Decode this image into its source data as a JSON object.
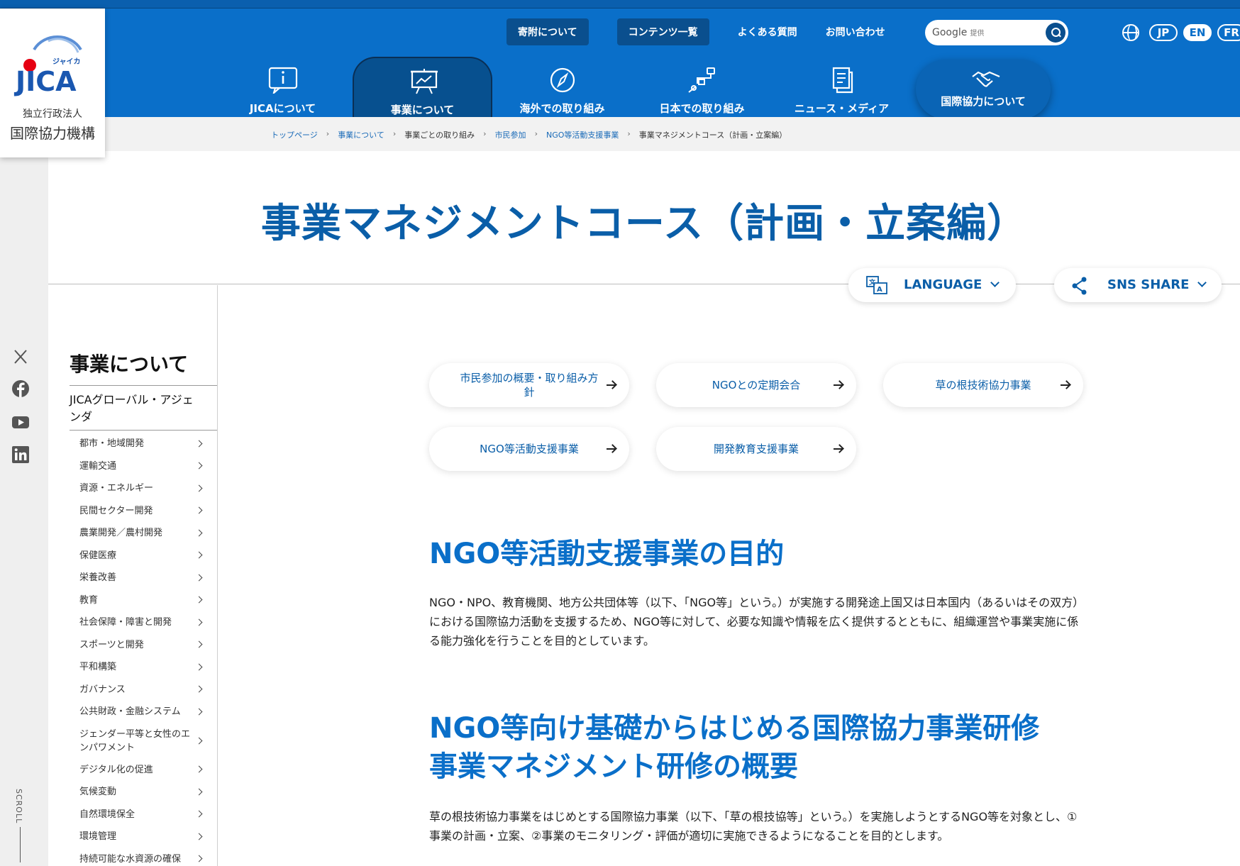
{
  "brand": {
    "logo_text": "JICA",
    "logo_kana": "ジャイカ",
    "org_type": "独立行政法人",
    "org_name": "国際協力機構"
  },
  "utility_nav": {
    "donation": "寄附について",
    "contents": "コンテンツ一覧",
    "faq": "よくある質問",
    "contact": "お問い合わせ"
  },
  "search": {
    "provider": "Google",
    "provided": "提供"
  },
  "languages": [
    "JP",
    "EN",
    "FR"
  ],
  "main_nav": [
    {
      "label": "JICAについて",
      "icon": "info-board-icon"
    },
    {
      "label": "事業について",
      "icon": "presentation-icon",
      "active": true
    },
    {
      "label": "海外での取り組み",
      "icon": "compass-icon"
    },
    {
      "label": "日本での取り組み",
      "icon": "route-icon"
    },
    {
      "label": "ニュース・メディア",
      "icon": "documents-icon"
    },
    {
      "label": "国際協力について",
      "icon": "handshake-icon"
    }
  ],
  "breadcrumb": [
    "トップページ",
    "事業について",
    "事業ごとの取り組み",
    "市民参加",
    "NGO等活動支援事業",
    "事業マネジメントコース（計画・立案編）"
  ],
  "page_title": "事業マネジメントコース（計画・立案編）",
  "language_btn": "LANGUAGE",
  "share_btn": "SNS SHARE",
  "social": [
    "x-icon",
    "facebook-icon",
    "youtube-icon",
    "linkedin-icon"
  ],
  "scroll_label": "SCROLL",
  "sidebar": {
    "heading": "事業について",
    "section": "JICAグローバル・アジェンダ",
    "items": [
      "都市・地域開発",
      "運輸交通",
      "資源・エネルギー",
      "民間セクター開発",
      "農業開発／農村開発",
      "保健医療",
      "栄養改善",
      "教育",
      "社会保障・障害と開発",
      "スポーツと開発",
      "平和構築",
      "ガバナンス",
      "公共財政・金融システム",
      "ジェンダー平等と女性のエンパワメント",
      "デジタル化の促進",
      "気候変動",
      "自然環境保全",
      "環境管理",
      "持続可能な水資源の確保"
    ]
  },
  "link_cards": [
    "市民参加の概要・取り組み方針",
    "NGOとの定期会合",
    "草の根技術協力事業",
    "NGO等活動支援事業",
    "開発教育支援事業"
  ],
  "section1": {
    "heading": "NGO等活動支援事業の目的",
    "body": "NGO・NPO、教育機関、地方公共団体等（以下、「NGO等」という。）が実施する開発途上国又は日本国内（あるいはその双方）における国際協力活動を支援するため、NGO等に対して、必要な知識や情報を広く提供するとともに、組織運営や事業実施に係る能力強化を行うことを目的としています。"
  },
  "section2": {
    "heading_line1": "NGO等向け基礎からはじめる国際協力事業研修",
    "heading_line2": "事業マネジメント研修の概要",
    "body": "草の根技術協力事業をはじめとする国際協力事業（以下、「草の根技協等」という。）を実施しようとするNGO等を対象とし、①事業の計画・立案、②事業のモニタリング・評価が適切に実施できるようになることを目的とします。"
  },
  "colors": {
    "header_blue": "#0a6fc9",
    "title_blue": "#0a5ea8",
    "jica_red": "#e60012"
  }
}
